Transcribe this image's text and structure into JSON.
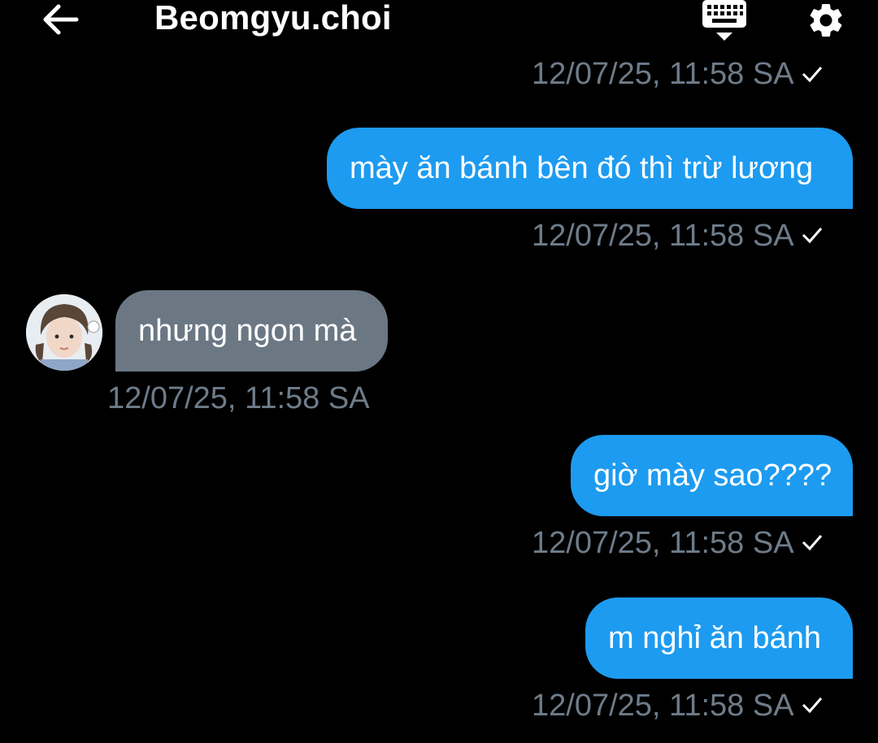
{
  "header": {
    "title": "Beomgyu.choi",
    "back_icon": "arrow-left-icon",
    "keyboard_icon": "keyboard-hide-icon",
    "settings_icon": "gear-icon"
  },
  "colors": {
    "background": "#000000",
    "sent_bubble": "#1d9bf0",
    "received_bubble": "#6b7884",
    "timestamp": "#6e7c8a"
  },
  "messages": [
    {
      "direction": "sent",
      "text": "",
      "timestamp": "12/07/25, 11:58 SA",
      "read": true,
      "partial": true
    },
    {
      "direction": "sent",
      "text": "mày ăn bánh bên đó thì trừ lương",
      "timestamp": "12/07/25, 11:58 SA",
      "read": true
    },
    {
      "direction": "received",
      "text": "nhưng ngon mà",
      "timestamp": "12/07/25, 11:58 SA"
    },
    {
      "direction": "sent",
      "text": "giờ mày sao????",
      "timestamp": "12/07/25, 11:58 SA",
      "read": true
    },
    {
      "direction": "sent",
      "text": "m nghỉ ăn bánh",
      "timestamp": "12/07/25, 11:58 SA",
      "read": true
    }
  ]
}
